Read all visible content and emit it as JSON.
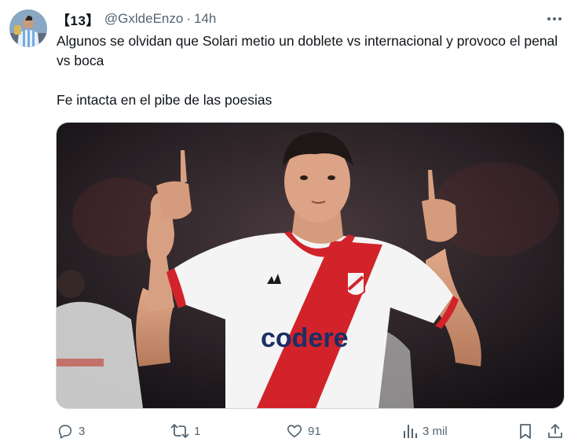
{
  "author": {
    "display_name": "【13】",
    "handle": "@GxldeEnzo",
    "separator": "·",
    "time": "14h"
  },
  "tweet": {
    "line1": "Algunos se olvidan que Solari metio un doblete vs internacional y provoco el penal vs boca",
    "line2": "Fe intacta en el pibe de las poesias"
  },
  "media": {
    "jersey_sponsor": "codere",
    "jersey_brand_colors": {
      "red": "#d2232a",
      "white": "#f4f4f4"
    }
  },
  "actions": {
    "replies": "3",
    "reposts": "1",
    "likes": "91",
    "views": "3 mil"
  },
  "icons": [
    "more-icon",
    "reply-icon",
    "repost-icon",
    "like-icon",
    "views-icon",
    "bookmark-icon",
    "share-icon"
  ],
  "colors": {
    "text": "#0f1419",
    "secondary": "#536471",
    "border": "#cfd9de"
  }
}
